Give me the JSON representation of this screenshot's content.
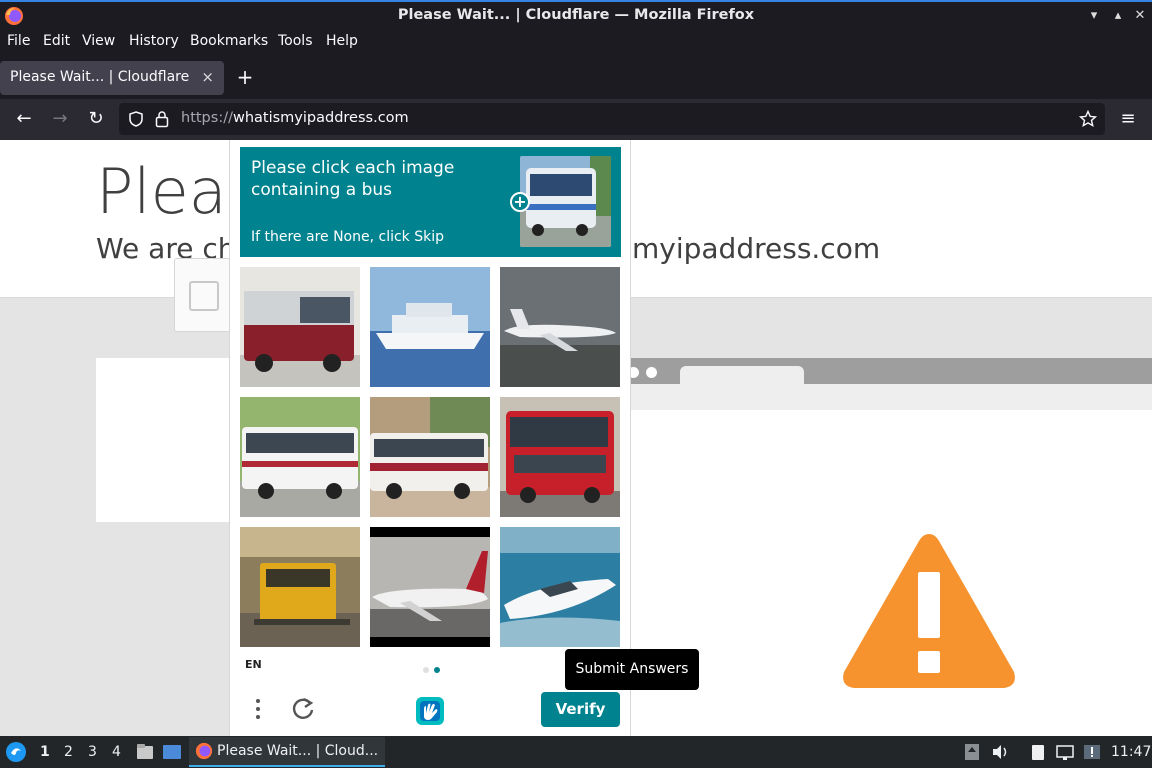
{
  "window": {
    "title": "Please Wait... | Cloudflare — Mozilla Firefox"
  },
  "menu": [
    "File",
    "Edit",
    "View",
    "History",
    "Bookmarks",
    "Tools",
    "Help"
  ],
  "tab": {
    "label": "Please Wait... | Cloudflare",
    "close": "×",
    "new": "+"
  },
  "url": {
    "scheme": "https://",
    "host": "whatismyipaddress.com"
  },
  "page": {
    "title": "Pleas",
    "subtitle_a": "We are ch",
    "subtitle_b": "myipaddress.com"
  },
  "captcha": {
    "prompt": "Please click each image containing a bus",
    "skip_hint": "If there are None, click Skip",
    "language": "EN",
    "verify_label": "Verify",
    "tooltip": "Submit Answers",
    "tiles": [
      "bus",
      "yacht",
      "airplane",
      "bus",
      "bus",
      "bus",
      "train",
      "airplane",
      "speedboat"
    ]
  },
  "taskbar": {
    "workspaces": [
      "1",
      "2",
      "3",
      "4"
    ],
    "active_task": "Please Wait... | Cloud...",
    "clock": "11:47"
  },
  "colors": {
    "accent": "#00838f",
    "warning": "#f6932f",
    "firefox_dark": "#1c1b22"
  }
}
